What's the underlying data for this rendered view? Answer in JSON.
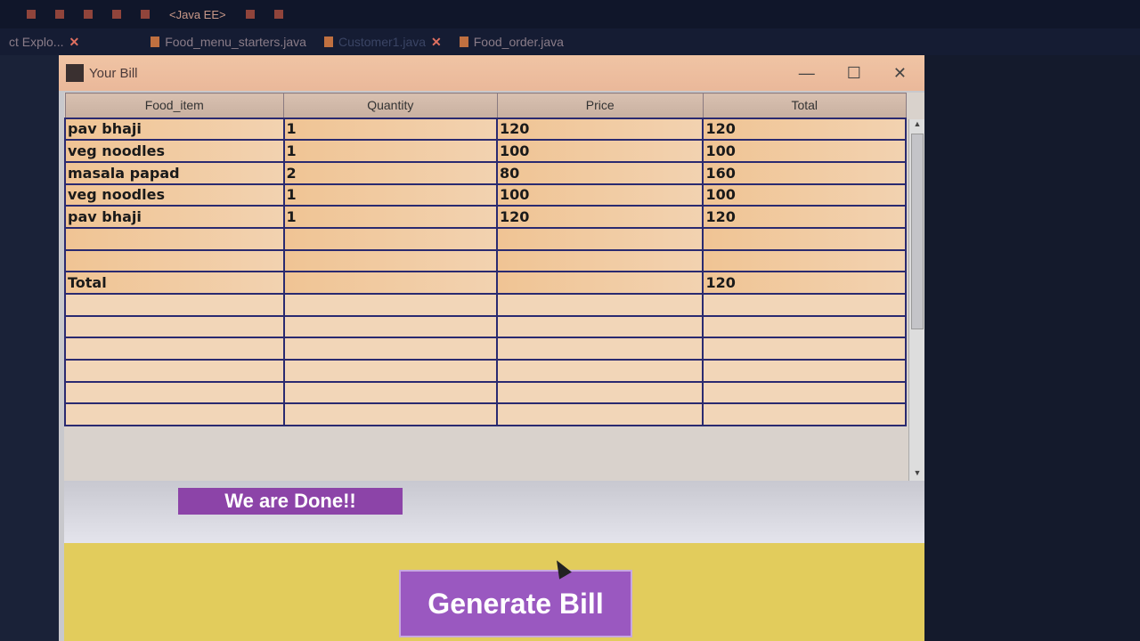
{
  "ide": {
    "perspective": "<Java EE>",
    "tabs": [
      {
        "label": "ct Explo..."
      },
      {
        "label": "Food_menu_starters.java"
      },
      {
        "label": "Customer1.java"
      },
      {
        "label": "Food_order.java"
      }
    ]
  },
  "window": {
    "title": "Your Bill",
    "controls": [
      "—",
      "☐",
      "✕"
    ]
  },
  "table": {
    "columns": [
      "Food_item",
      "Quantity",
      "Price",
      "Total"
    ],
    "rows": [
      [
        "pav bhaji",
        "1",
        "120",
        "120"
      ],
      [
        "veg noodles",
        "1",
        "100",
        "100"
      ],
      [
        "masala papad",
        "2",
        "80",
        "160"
      ],
      [
        "veg noodles",
        "1",
        "100",
        "100"
      ],
      [
        "pav bhaji",
        "1",
        "120",
        "120"
      ],
      [
        "",
        "",
        "",
        ""
      ],
      [
        "",
        "",
        "",
        ""
      ],
      [
        "Total",
        "",
        "",
        "120"
      ],
      [
        "",
        "",
        "",
        ""
      ],
      [
        "",
        "",
        "",
        ""
      ],
      [
        "",
        "",
        "",
        ""
      ],
      [
        "",
        "",
        "",
        ""
      ],
      [
        "",
        "",
        "",
        ""
      ],
      [
        "",
        "",
        "",
        ""
      ]
    ]
  },
  "buttons": {
    "done": "We are Done!!",
    "generate": "Generate Bill"
  },
  "colors": {
    "button_purple": "#8c44a8",
    "panel_yellow": "#e2cc5c",
    "titlebar": "#eab89a"
  }
}
